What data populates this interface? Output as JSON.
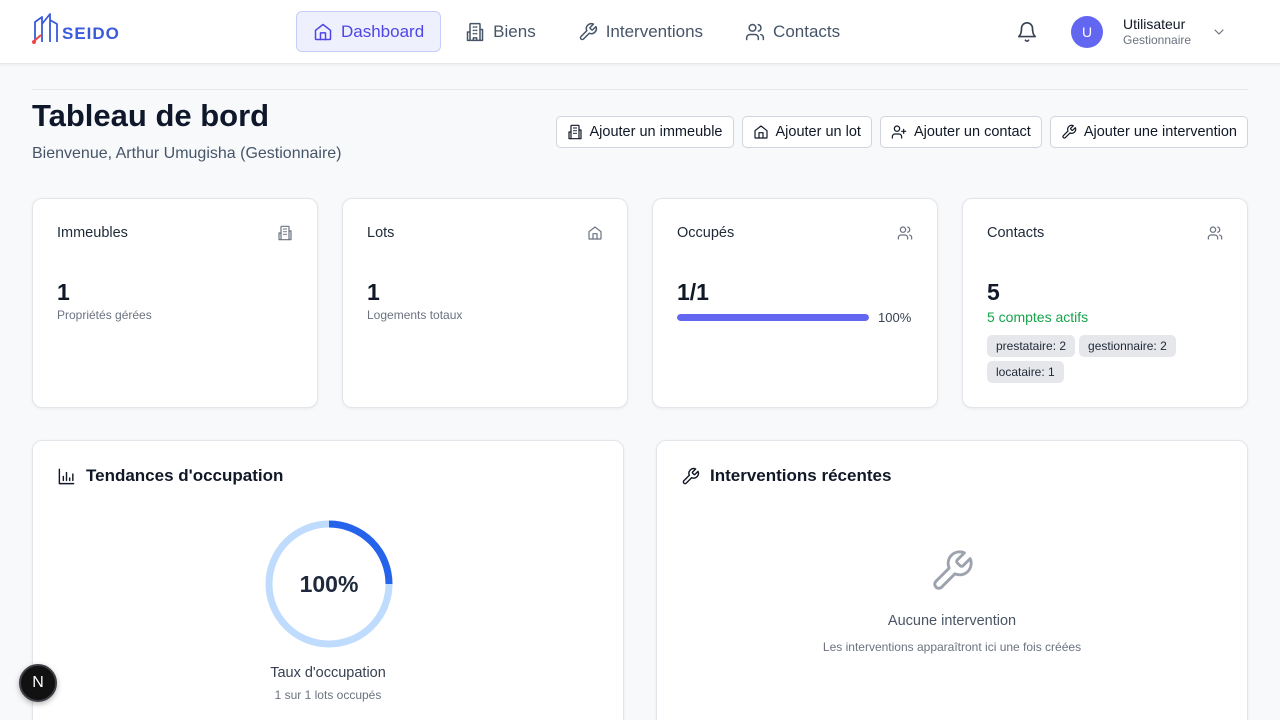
{
  "brand": {
    "name": "SEIDO"
  },
  "nav": [
    {
      "label": "Dashboard",
      "active": true,
      "icon": "home-icon"
    },
    {
      "label": "Biens",
      "active": false,
      "icon": "building-icon"
    },
    {
      "label": "Interventions",
      "active": false,
      "icon": "wrench-icon"
    },
    {
      "label": "Contacts",
      "active": false,
      "icon": "users-icon"
    }
  ],
  "user": {
    "initial": "U",
    "name": "Utilisateur",
    "role": "Gestionnaire"
  },
  "page": {
    "title": "Tableau de bord",
    "subtitle": "Bienvenue, Arthur Umugisha (Gestionnaire)"
  },
  "actions": [
    {
      "label": "Ajouter un immeuble",
      "icon": "building-icon"
    },
    {
      "label": "Ajouter un lot",
      "icon": "home-icon"
    },
    {
      "label": "Ajouter un contact",
      "icon": "user-plus-icon"
    },
    {
      "label": "Ajouter une intervention",
      "icon": "wrench-icon"
    }
  ],
  "stats": {
    "immeubles": {
      "label": "Immeubles",
      "value": "1",
      "sub": "Propriétés gérées"
    },
    "lots": {
      "label": "Lots",
      "value": "1",
      "sub": "Logements totaux"
    },
    "occupes": {
      "label": "Occupés",
      "value": "1/1",
      "percent_text": "100%",
      "percent": 100
    },
    "contacts": {
      "label": "Contacts",
      "value": "5",
      "active": "5 comptes actifs",
      "tags": [
        "prestataire: 2",
        "gestionnaire: 2",
        "locataire: 1"
      ]
    }
  },
  "occupancy": {
    "title": "Tendances d'occupation",
    "percent_text": "100%",
    "percent": 100,
    "label": "Taux d'occupation",
    "sub": "1 sur 1 lots occupés"
  },
  "interventions": {
    "title": "Interventions récentes",
    "empty_title": "Aucune intervention",
    "empty_sub": "Les interventions apparaîtront ici une fois créées"
  },
  "badge": {
    "letter": "N"
  },
  "colors": {
    "accent": "#6366f1",
    "brand": "#3b5bdb",
    "success": "#16a34a",
    "donut_track": "#bfdbfe",
    "donut_arc": "#2563eb"
  }
}
